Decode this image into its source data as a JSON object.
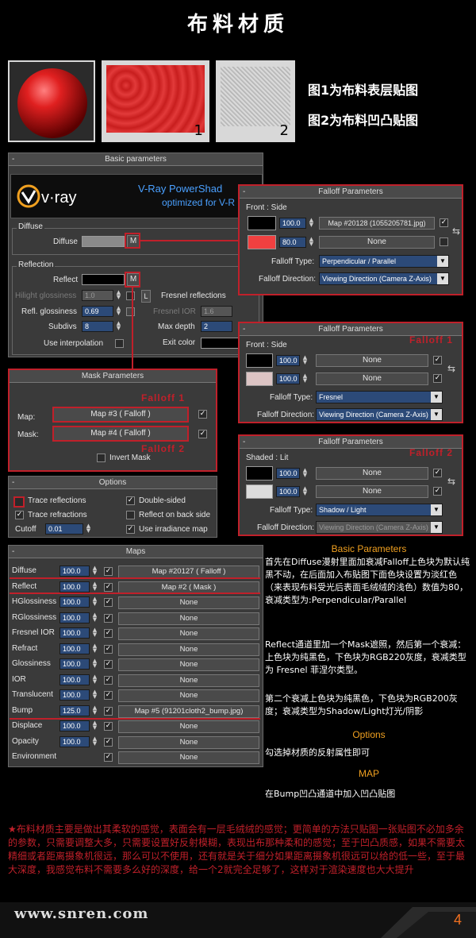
{
  "header": {
    "title": "布料材质",
    "fig1_num": "1",
    "fig2_num": "2",
    "caption1": "图1为布料表层贴图",
    "caption2": "图2为布料凹凸贴图"
  },
  "basic": {
    "minus": "-",
    "title": "Basic parameters",
    "banner_line1": "V-Ray PowerShad",
    "banner_line2": "optimized for V-R",
    "diffuse_group": "Diffuse",
    "diffuse_label": "Diffuse",
    "m": "M",
    "l": "L",
    "reflection_group": "Reflection",
    "reflect_label": "Reflect",
    "hilight_label": "Hilight glossiness",
    "hilight_value": "1.0",
    "refl_gloss_label": "Refl. glossiness",
    "refl_gloss_value": "0.69",
    "subdivs_label": "Subdivs",
    "subdivs_value": "8",
    "use_interp_label": "Use interpolation",
    "fresnel_label": "Fresnel reflections",
    "fresnel_ior_label": "Fresnel IOR",
    "fresnel_ior_value": "1.6",
    "max_depth_label": "Max depth",
    "max_depth_value": "2",
    "exit_color_label": "Exit color"
  },
  "falloff_diffuse": {
    "minus": "-",
    "title": "Falloff Parameters",
    "group": "Front : Side",
    "amount1": "100.0",
    "map1": "Map #20128 (1055205781.jpg)",
    "amount2": "80.0",
    "map2": "None",
    "check": "✓",
    "type_label": "Falloff Type:",
    "type_value": "Perpendicular / Parallel",
    "direction_label": "Falloff Direction:",
    "direction_value": "Viewing Direction (Camera Z-Axis)"
  },
  "mask": {
    "title": "Mask Parameters",
    "falloff1_tag": "Falloff 1",
    "falloff2_tag": "Falloff 2",
    "map_label": "Map:",
    "map_value": "Map #3  ( Falloff )",
    "mask_label": "Mask:",
    "mask_value": "Map #4  ( Falloff )",
    "check": "✓",
    "invert_label": "Invert Mask"
  },
  "falloff1": {
    "minus": "-",
    "title": "Falloff Parameters",
    "group": "Front : Side",
    "tag": "Falloff 1",
    "amount1": "100.0",
    "map1": "None",
    "amount2": "100.0",
    "map2": "None",
    "check": "✓",
    "type_label": "Falloff Type:",
    "type_value": "Fresnel",
    "direction_label": "Falloff Direction:",
    "direction_value": "Viewing Direction (Camera Z-Axis)"
  },
  "falloff2": {
    "minus": "-",
    "title": "Falloff Parameters",
    "group": "Shaded : Lit",
    "tag": "Falloff 2",
    "amount1": "100.0",
    "map1": "None",
    "amount2": "100.0",
    "map2": "None",
    "check": "✓",
    "type_label": "Falloff Type:",
    "type_value": "Shadow / Light",
    "direction_label": "Falloff Direction:",
    "direction_value": "Viewing Direction (Camera Z-Axis)"
  },
  "options": {
    "minus": "-",
    "title": "Options",
    "trace_reflections": "Trace reflections",
    "double_sided": "Double-sided",
    "trace_refractions": "Trace refractions",
    "reflect_back": "Reflect on back side",
    "cutoff_label": "Cutoff",
    "cutoff_value": "0.01",
    "irradiance": "Use irradiance map",
    "check": "✓"
  },
  "maps": {
    "minus": "-",
    "title": "Maps",
    "rows": [
      {
        "name": "Diffuse",
        "amount": "100.0",
        "checked": true,
        "map": "Map #20127  ( Falloff )"
      },
      {
        "name": "Reflect",
        "amount": "100.0",
        "checked": true,
        "map": "Map #2  ( Mask )"
      },
      {
        "name": "HGlossiness",
        "amount": "100.0",
        "checked": true,
        "map": "None"
      },
      {
        "name": "RGlossiness",
        "amount": "100.0",
        "checked": true,
        "map": "None"
      },
      {
        "name": "Fresnel IOR",
        "amount": "100.0",
        "checked": true,
        "map": "None"
      },
      {
        "name": "Refract",
        "amount": "100.0",
        "checked": true,
        "map": "None"
      },
      {
        "name": "Glossiness",
        "amount": "100.0",
        "checked": true,
        "map": "None"
      },
      {
        "name": "IOR",
        "amount": "100.0",
        "checked": true,
        "map": "None"
      },
      {
        "name": "Translucent",
        "amount": "100.0",
        "checked": true,
        "map": "None"
      },
      {
        "name": "Bump",
        "amount": "125.0",
        "checked": true,
        "map": "Map #5 (91201cloth2_bump.jpg)"
      },
      {
        "name": "Displace",
        "amount": "100.0",
        "checked": true,
        "map": "None"
      },
      {
        "name": "Opacity",
        "amount": "100.0",
        "checked": true,
        "map": "None"
      },
      {
        "name": "Environment",
        "amount": "",
        "checked": true,
        "map": "None"
      }
    ]
  },
  "desc": {
    "basic_heading": "Basic Parameters",
    "basic_text": "首先在Diffuse漫射里面加衰减Falloff上色块为默认纯黑不动，在后面加入布贴图下面色块设置为淡红色（来表现布料受光后表面毛绒绒的浅色）数值为80，衰减类型为:Perpendicular/Parallel",
    "reflect_text": "Reflect通道里加一个Mask遮照，然后第一个衰减：上色块为纯黑色，下色块为RGB220灰度，衰减类型为 Fresnel 菲涅尔类型。",
    "falloff2_text": "第二个衰减上色块为纯黑色，下色块为RGB200灰度；衰减类型为Shadow/Light灯光/阴影",
    "options_heading": "Options",
    "options_text": "勾选掉材质的反射属性即可",
    "map_heading": "MAP",
    "map_text": "在Bump凹凸通道中加入凹凸贴图"
  },
  "footer": {
    "note": "★布料材质主要是做出其柔软的感觉，表面会有一层毛绒绒的感觉；更简单的方法只贴图一张贴图不必加多余的参数，只需要调整大多，只需要设置好反射模糊，表现出布那种柔和的感觉；至于凹凸质感，如果不需要太精细或者距离摄象机很远，那么可以不使用，还有就是关于细分如果距离摄象机很远可以给的低一些，至于最大深度，我感觉布料不需要多么好的深度，给一个2就完全足够了，这样对于渲染速度也大大提升",
    "site": "www.snren.com",
    "page": "4"
  }
}
